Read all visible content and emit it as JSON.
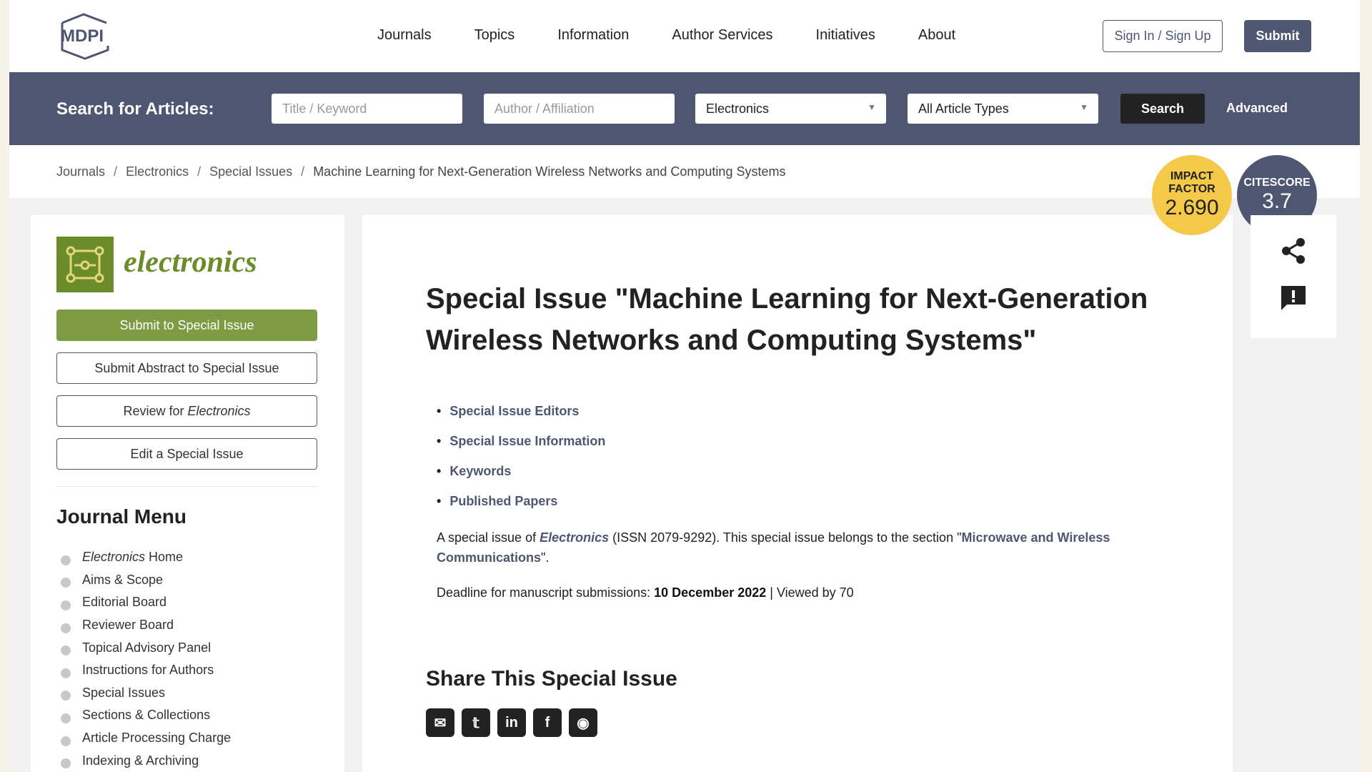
{
  "header": {
    "logo_text": "MDPI",
    "nav": [
      "Journals",
      "Topics",
      "Information",
      "Author Services",
      "Initiatives",
      "About"
    ],
    "signin_label": "Sign In / Sign Up",
    "submit_label": "Submit"
  },
  "search": {
    "label": "Search for Articles:",
    "keyword_placeholder": "Title / Keyword",
    "author_placeholder": "Author / Affiliation",
    "journal_selected": "Electronics",
    "type_selected": "All Article Types",
    "search_button": "Search",
    "advanced_link": "Advanced"
  },
  "breadcrumb": {
    "items": [
      "Journals",
      "Electronics",
      "Special Issues"
    ],
    "current": "Machine Learning for Next-Generation Wireless Networks and Computing Systems"
  },
  "badges": {
    "impact_label": "IMPACT FACTOR",
    "impact_value": "2.690",
    "citescore_label": "CITESCORE",
    "citescore_value": "3.7"
  },
  "sidebar": {
    "journal_name": "electronics",
    "buttons": {
      "submit": "Submit to Special Issue",
      "abstract": "Submit Abstract to Special Issue",
      "review_prefix": "Review for ",
      "review_journal": "Electronics",
      "edit": "Edit a Special Issue"
    },
    "menu_title": "Journal Menu",
    "menu_home_journal": "Electronics",
    "menu_home_suffix": " Home",
    "menu": [
      "Aims & Scope",
      "Editorial Board",
      "Reviewer Board",
      "Topical Advisory Panel",
      "Instructions for Authors",
      "Special Issues",
      "Sections & Collections",
      "Article Processing Charge",
      "Indexing & Archiving"
    ]
  },
  "main": {
    "title": "Special Issue \"Machine Learning for Next-Generation Wireless Networks and Computing Systems\"",
    "toc": [
      "Special Issue Editors",
      "Special Issue Information",
      "Keywords",
      "Published Papers"
    ],
    "para_prefix": "A special issue of ",
    "para_journal": "Electronics",
    "para_mid": " (ISSN 2079-9292). This special issue belongs to the section \"",
    "para_section": "Microwave and Wireless Communications",
    "para_suffix": "\".",
    "deadline_label": "Deadline for manuscript submissions: ",
    "deadline_date": "10 December 2022",
    "views": " | Viewed by 70",
    "share_title": "Share This Special Issue"
  },
  "colors": {
    "brand": "#4f5671",
    "journal_green": "#7c9b42",
    "impact_yellow": "#f4c94a"
  }
}
